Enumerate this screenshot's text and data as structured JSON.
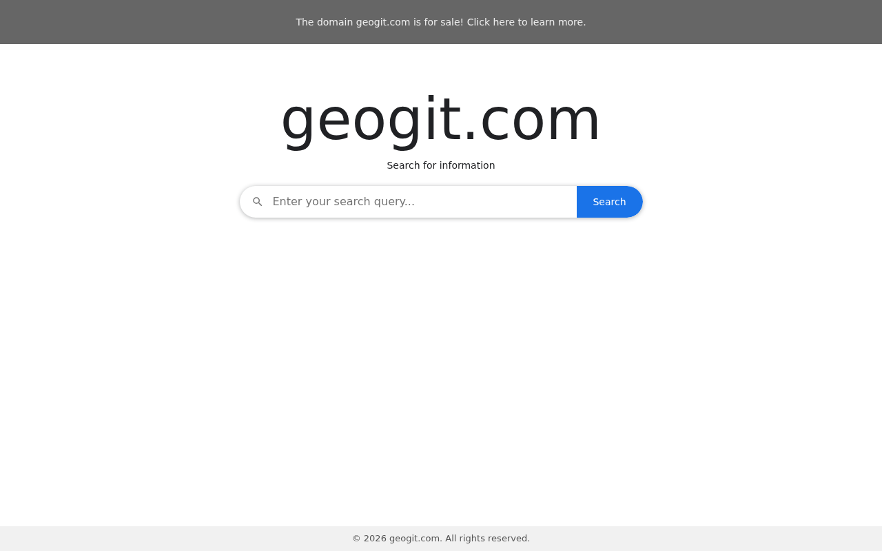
{
  "banner": {
    "text": "The domain geogit.com is for sale! Click here to learn more."
  },
  "site_title": "geogit.com",
  "tagline": "Search for information",
  "search": {
    "placeholder": "Enter your search query...",
    "button": "Search"
  },
  "footer": {
    "text": "© 2026 geogit.com. All rights reserved."
  }
}
